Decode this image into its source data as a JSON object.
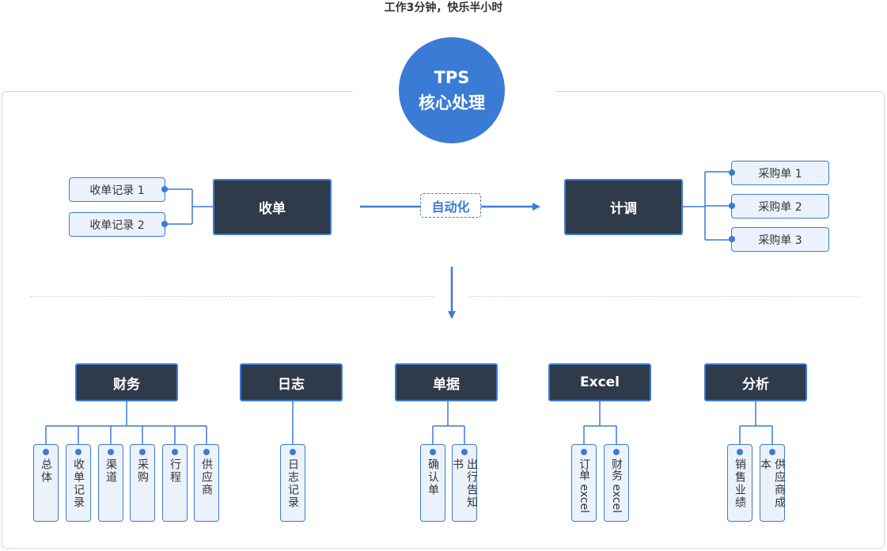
{
  "header": {
    "subtitle": "工作3分钟，快乐半小时"
  },
  "core": {
    "line1": "TPS",
    "line2": "核心处理"
  },
  "flow": {
    "receive_label": "收单",
    "receive_records": [
      "收单记录 1",
      "收单记录 2"
    ],
    "auto_label": "自动化",
    "plan_label": "计调",
    "purchase_orders": [
      "采购单 1",
      "采购单 2",
      "采购单 3"
    ]
  },
  "categories": [
    {
      "name": "财务",
      "items": [
        "总体",
        "收单记录",
        "渠道",
        "采购",
        "行程",
        "供应商"
      ]
    },
    {
      "name": "日志",
      "items": [
        "日志记录"
      ]
    },
    {
      "name": "单据",
      "items": [
        "确认单",
        "出行告知书"
      ]
    },
    {
      "name": "Excel",
      "items": [
        "订单 excel",
        "财务 excel"
      ]
    },
    {
      "name": "分析",
      "items": [
        "销售业绩",
        "供应商成本"
      ]
    }
  ],
  "colors": {
    "accent": "#3a7bd5",
    "dark": "#2f3a4b",
    "tag_bg": "#ecf2fc"
  }
}
